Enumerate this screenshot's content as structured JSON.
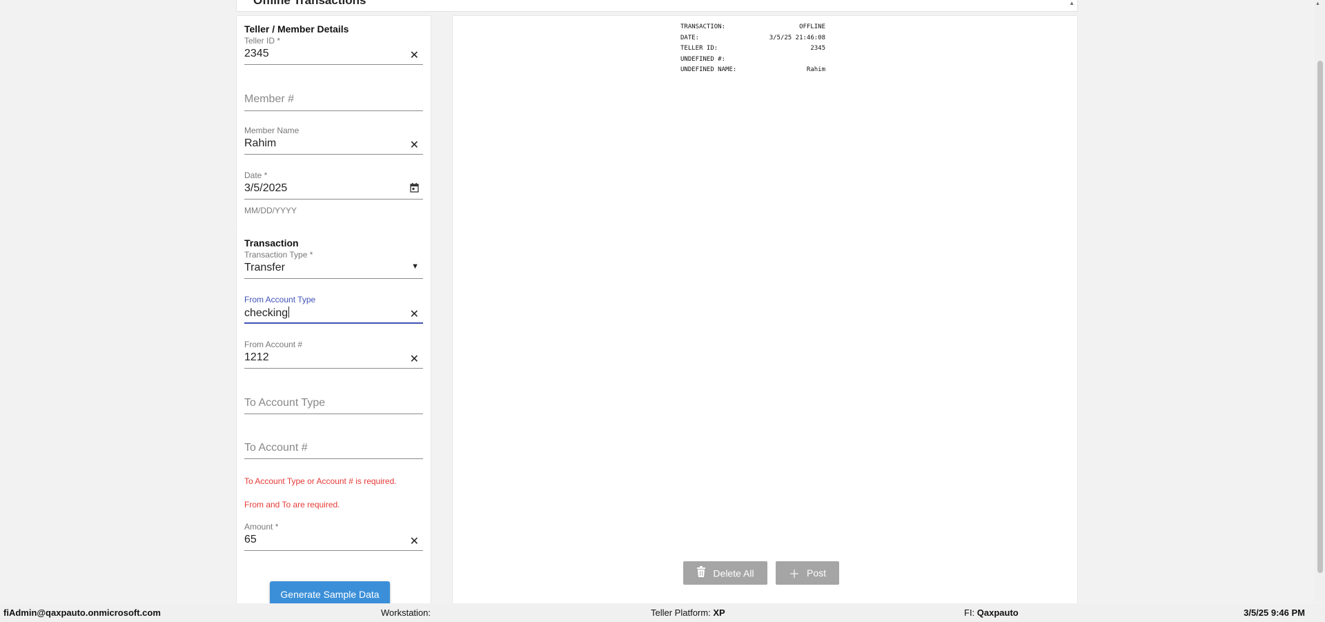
{
  "page_title": "Offline Transactions",
  "member_section": {
    "title": "Teller / Member Details",
    "teller_id": {
      "label": "Teller ID *",
      "value": "2345"
    },
    "member_number": {
      "placeholder": "Member #"
    },
    "member_name": {
      "label": "Member Name",
      "value": "Rahim"
    },
    "date": {
      "label": "Date *",
      "value": "3/5/2025",
      "hint": "MM/DD/YYYY"
    }
  },
  "transaction_section": {
    "title": "Transaction",
    "transaction_type": {
      "label": "Transaction Type *",
      "value": "Transfer"
    },
    "from_account_type": {
      "label": "From Account Type",
      "value": "checking"
    },
    "from_account_number": {
      "label": "From Account #",
      "value": "1212"
    },
    "to_account_type": {
      "placeholder": "To Account Type"
    },
    "to_account_number": {
      "placeholder": "To Account #"
    },
    "errors": [
      "To Account Type or Account # is required.",
      "From and To are required."
    ],
    "amount": {
      "label": "Amount *",
      "value": "65"
    },
    "generate_button": "Generate Sample Data"
  },
  "receipt": [
    {
      "label": "TRANSACTION:",
      "value": "OFFLINE"
    },
    {
      "label": "DATE:",
      "value": "3/5/25 21:46:08"
    },
    {
      "label": "TELLER ID:",
      "value": "2345"
    },
    {
      "label": "UNDEFINED #:",
      "value": ""
    },
    {
      "label": "UNDEFINED NAME:",
      "value": "Rahim"
    }
  ],
  "actions": {
    "delete_all": "Delete All",
    "post": "Post"
  },
  "icons": {
    "clear": "close-icon",
    "calendar": "calendar-icon",
    "dropdown": "dropdown-arrow-icon",
    "delete": "trash-icon",
    "add": "plus-icon"
  },
  "colors": {
    "accent": "#3f51b5",
    "error": "#e53935",
    "button_primary": "#3b8fd8",
    "button_disabled": "#a5a5a5"
  },
  "status_bar": {
    "user": "fiAdmin@qaxpauto.onmicrosoft.com",
    "workstation_label": "Workstation:",
    "workstation_value": "",
    "platform_label": "Teller Platform:",
    "platform_value": "XP",
    "fi_label": "FI:",
    "fi_value": "Qaxpauto",
    "datetime": "3/5/25 9:46 PM"
  }
}
